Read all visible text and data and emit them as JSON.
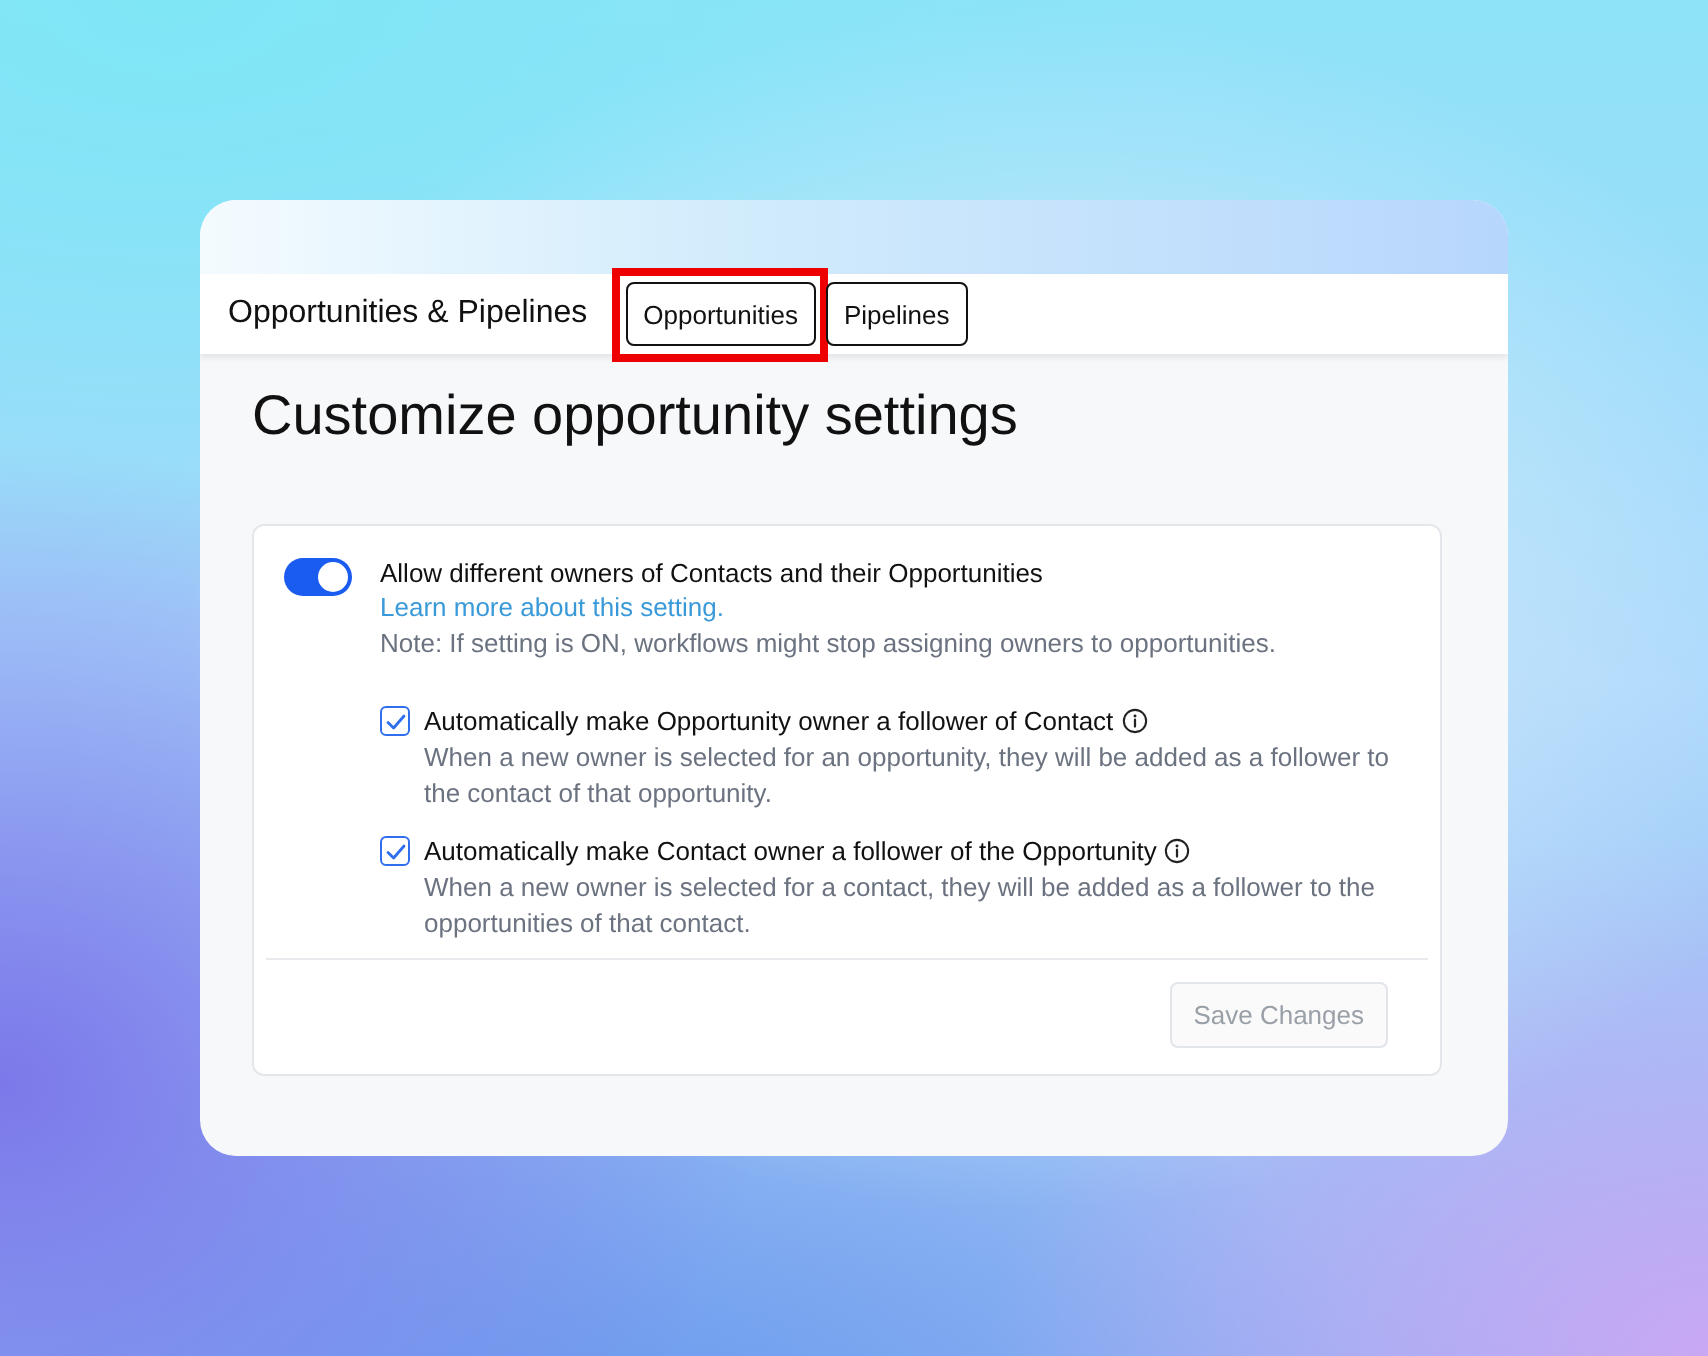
{
  "header": {
    "title": "Opportunities & Pipelines",
    "tabs": [
      {
        "label": "Opportunities",
        "highlighted": true
      },
      {
        "label": "Pipelines",
        "highlighted": false
      }
    ]
  },
  "heading": "Customize opportunity settings",
  "setting": {
    "toggle_on": true,
    "title": "Allow different owners of Contacts and their Opportunities",
    "link": "Learn more about this setting.",
    "note": "Note: If setting is ON, workflows might stop assigning owners to opportunities.",
    "options": [
      {
        "label": "Automatically make Opportunity owner a follower of Contact",
        "checked": true,
        "description": "When a new owner is selected for an opportunity, they will be added as a follower to the contact of that opportunity."
      },
      {
        "label": "Automatically make Contact owner a follower of the Opportunity",
        "checked": true,
        "description": "When a new owner is selected for a contact, they will be added as a follower to the opportunities of that contact."
      }
    ]
  },
  "save_button": {
    "label": "Save Changes",
    "disabled": true
  }
}
